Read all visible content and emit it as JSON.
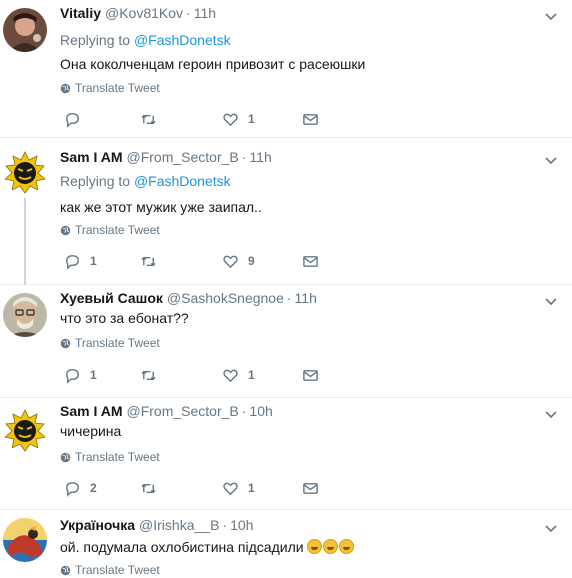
{
  "labels": {
    "replying_to": "Replying to",
    "translate": "Translate Tweet"
  },
  "tweets": [
    {
      "name": "Vitaliy",
      "handle": "@Kov81Kov",
      "time": "11h",
      "reply_to": "@FashDonetsk",
      "text": "Она коколченцам героин привозит с расеюшки",
      "replies": "",
      "retweets": "",
      "likes": "1"
    },
    {
      "name": "Sam I AM",
      "handle": "@From_Sector_B",
      "time": "11h",
      "reply_to": "@FashDonetsk",
      "text": "как же этот мужик уже заипал..",
      "replies": "1",
      "retweets": "",
      "likes": "9"
    },
    {
      "name": "Хуевый Сашок",
      "handle": "@SashokSnegnoe",
      "time": "11h",
      "reply_to": "",
      "text": "что это за ебонат??",
      "replies": "1",
      "retweets": "",
      "likes": "1"
    },
    {
      "name": "Sam I AM",
      "handle": "@From_Sector_B",
      "time": "10h",
      "reply_to": "",
      "text": "чичерина",
      "replies": "2",
      "retweets": "",
      "likes": "1"
    },
    {
      "name": "Україночка",
      "handle": "@Irishka__B",
      "time": "10h",
      "reply_to": "",
      "text": "ой. подумала охлобистина підсадили",
      "emoji": "rolling-on-floor-laughing-emoji",
      "replies": "",
      "retweets": "",
      "likes": ""
    }
  ],
  "colors": {
    "link": "#1b95e0",
    "secondary": "#657786",
    "divider": "#e6ecf0"
  }
}
